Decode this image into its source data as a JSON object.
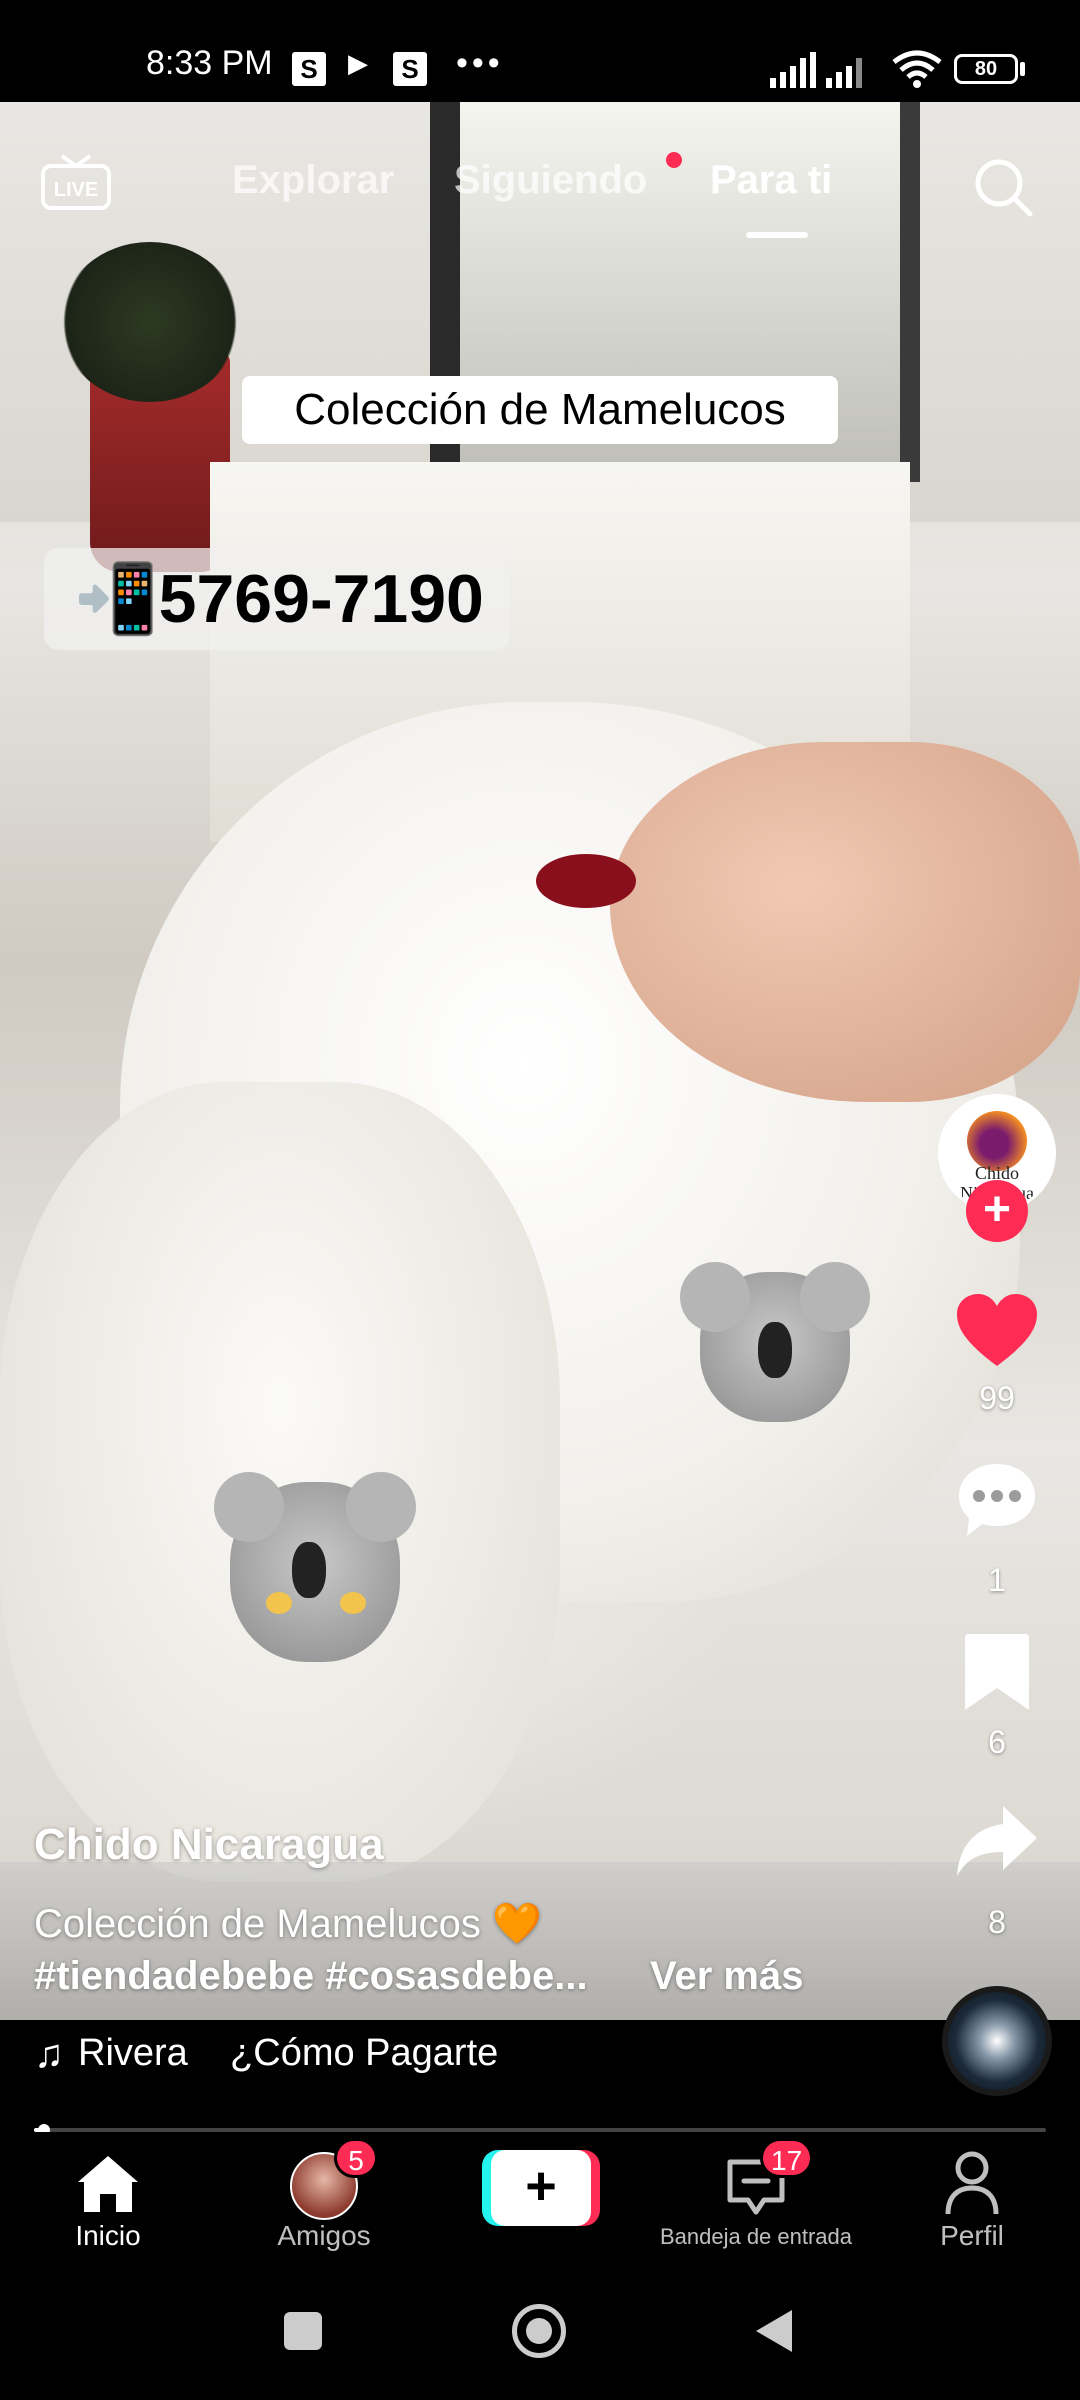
{
  "status_bar": {
    "time": "8:33 PM",
    "notif_icons": [
      "S",
      "▶",
      "S"
    ],
    "more": "•••",
    "battery": "80"
  },
  "top_nav": {
    "tabs": [
      "Explorar",
      "Siguiendo",
      "Para ti"
    ],
    "active_tab": "Para ti"
  },
  "video": {
    "overlay_title": "Colección de Mamelucos",
    "overlay_phone": "📲5769-7190",
    "progress_fraction": 0.01
  },
  "right_rail": {
    "avatar_text": "Chido Nicaragua",
    "likes": "99",
    "comments": "1",
    "saves": "6",
    "shares": "8"
  },
  "caption": {
    "creator": "Chido Nicaragua",
    "text": "Colección de Mamelucos 🧡",
    "hashtags": "#tiendadebebe #cosasdebe...",
    "more": "Ver más"
  },
  "music": {
    "note": "♫",
    "text": "Rivera    ¿Cómo Pagarte"
  },
  "bottom_nav": {
    "items": [
      {
        "label": "Inicio"
      },
      {
        "label": "Amigos",
        "badge": "5"
      },
      {
        "label": "+"
      },
      {
        "label": "Bandeja de entrada",
        "badge": "17"
      },
      {
        "label": "Perfil"
      }
    ]
  },
  "colors": {
    "accent": "#fe2c55",
    "cyan": "#25f4ee"
  }
}
